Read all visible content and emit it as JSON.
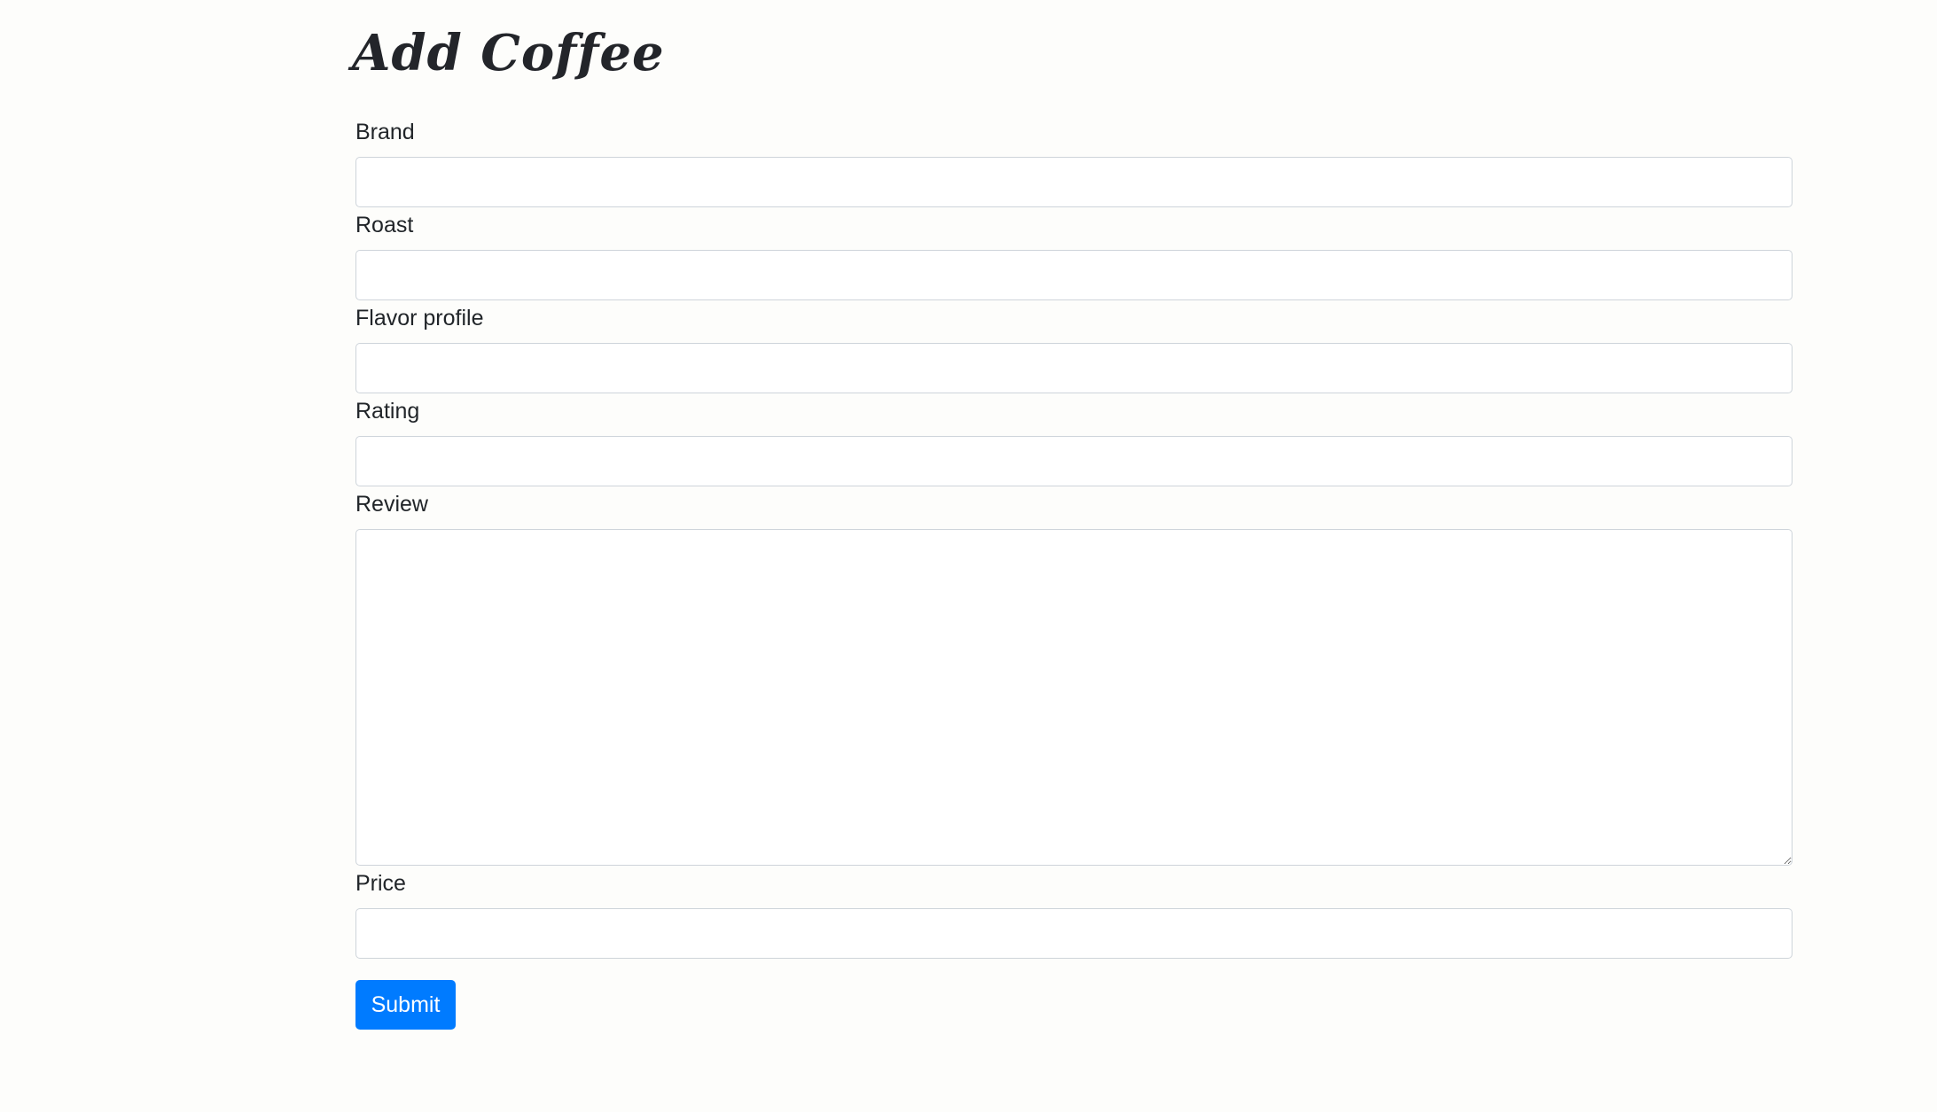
{
  "page": {
    "title": "Add Coffee"
  },
  "form": {
    "brand": {
      "label": "Brand",
      "value": "",
      "placeholder": ""
    },
    "roast": {
      "label": "Roast",
      "value": "",
      "placeholder": ""
    },
    "flavor_profile": {
      "label": "Flavor profile",
      "value": "",
      "placeholder": ""
    },
    "rating": {
      "label": "Rating",
      "value": "",
      "placeholder": ""
    },
    "review": {
      "label": "Review",
      "value": "",
      "placeholder": ""
    },
    "price": {
      "label": "Price",
      "value": "",
      "placeholder": ""
    },
    "submit_label": "Submit"
  },
  "colors": {
    "primary_button": "#007bff",
    "background": "#fdfdfb",
    "input_border": "#ced4da"
  }
}
